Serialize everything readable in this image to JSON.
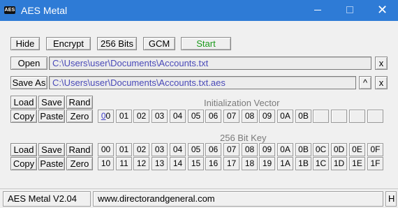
{
  "window": {
    "title": "AES Metal",
    "icon_text": "AES"
  },
  "toolbar": {
    "hide": "Hide",
    "encrypt": "Encrypt",
    "bits": "256 Bits",
    "mode": "GCM",
    "start": "Start"
  },
  "file": {
    "open_label": "Open",
    "open_path": "C:\\Users\\user\\Documents\\Accounts.txt",
    "open_clear": "x",
    "saveas_label": "Save As",
    "saveas_path": "C:\\Users\\user\\Documents\\Accounts.txt.aes",
    "saveas_up": "^",
    "saveas_clear": "x"
  },
  "iv": {
    "title": "Initialization Vector",
    "load": "Load",
    "save": "Save",
    "rand": "Rand",
    "copy": "Copy",
    "paste": "Paste",
    "zero": "Zero",
    "bytes": [
      "00",
      "01",
      "02",
      "03",
      "04",
      "05",
      "06",
      "07",
      "08",
      "09",
      "0A",
      "0B",
      "",
      "",
      "",
      ""
    ]
  },
  "key": {
    "title": "256 Bit Key",
    "load": "Load",
    "save": "Save",
    "rand": "Rand",
    "copy": "Copy",
    "paste": "Paste",
    "zero": "Zero",
    "row1": [
      "00",
      "01",
      "02",
      "03",
      "04",
      "05",
      "06",
      "07",
      "08",
      "09",
      "0A",
      "0B",
      "0C",
      "0D",
      "0E",
      "0F"
    ],
    "row2": [
      "10",
      "11",
      "12",
      "13",
      "14",
      "15",
      "16",
      "17",
      "18",
      "19",
      "1A",
      "1B",
      "1C",
      "1D",
      "1E",
      "1F"
    ]
  },
  "status": {
    "version": "AES Metal V2.04",
    "url": "www.directorandgeneral.com",
    "help": "H"
  },
  "colors": {
    "titlebar": "#2e7bd6",
    "path_text": "#4a4ab8",
    "start_text": "#1a9a1a",
    "section_label": "#7a7a7a"
  }
}
